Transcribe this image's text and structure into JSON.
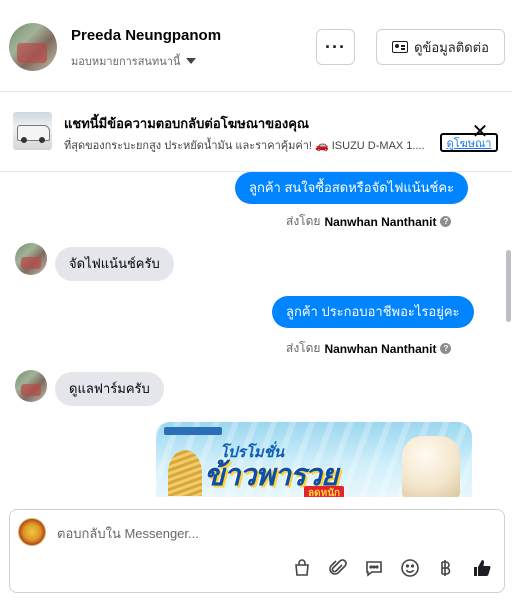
{
  "header": {
    "user_name": "Preeda Neungpanom",
    "assign_label": "มอบหมายการสนทนานี้",
    "more_label": "···",
    "contact_button_label": "ดูข้อมูลติดต่อ"
  },
  "ad_banner": {
    "title": "แชทนี้มีข้อความตอบกลับต่อโฆษณาของคุณ",
    "description": "ที่สุดของกระบะยกสูง ประหยัดน้ำมัน และราคาคุ้มค่า! 🚗 ISUZU D-MAX 1....",
    "link_label": "ดูโฆษณา",
    "close_label": "✕"
  },
  "messages": [
    {
      "direction": "out",
      "text": "ลูกค้า  สนใจซื้อสดหรือจัดไฟแน้นช์คะ",
      "sent_by_prefix": "ส่งโดย",
      "sender": "Nanwhan Nanthanit"
    },
    {
      "direction": "in",
      "text": "จัดไฟแน้นช์ครับ"
    },
    {
      "direction": "out",
      "text": "ลูกค้า ประกอบอาชีพอะไรอยู่คะ",
      "sent_by_prefix": "ส่งโดย",
      "sender": "Nanwhan Nanthanit"
    },
    {
      "direction": "in",
      "text": "ดูแลฟาร์มครับ"
    }
  ],
  "promo_image": {
    "tag": "โปรโมชั่น",
    "title": "ข้าวพารวย",
    "subtitle": "ลดหนัก"
  },
  "composer": {
    "placeholder": "ตอบกลับใน Messenger..."
  },
  "icons": [
    "shopping-bag-icon",
    "paperclip-icon",
    "saved-reply-icon",
    "emoji-icon",
    "baht-icon",
    "thumbs-up-icon"
  ],
  "colors": {
    "accent": "#0084ff",
    "incoming_bubble": "#e4e6eb",
    "like_button": "#0084ff"
  }
}
